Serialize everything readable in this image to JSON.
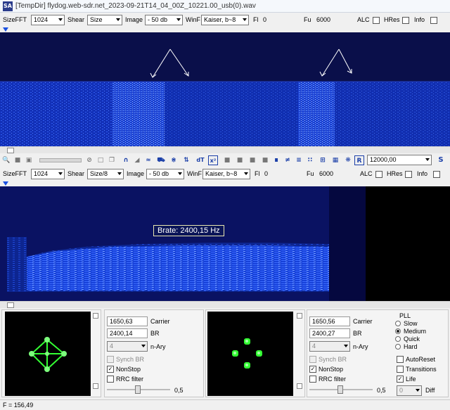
{
  "window": {
    "icon_text": "SA",
    "title": "[TempDir] flydog.web-sdr.net_2023-09-21T14_04_00Z_10221.00_usb(0).wav"
  },
  "top_controls": {
    "sizefft_label": "SizeFFT",
    "sizefft_value": "1024",
    "shear_label": "Shear",
    "shear_value": "Size",
    "image_label": "Image",
    "image_value": "- 50 db",
    "winf_label": "WinF",
    "winf_value": "Kaiser, b~8",
    "fl_label": "Fl",
    "fl_value": "0",
    "fu_label": "Fu",
    "fu_value": "6000",
    "alc_label": "ALC",
    "hres_label": "HRes",
    "info_label": "Info"
  },
  "toolbar": {
    "frequency_value": "12000,00",
    "s_button": "S",
    "r_button": "R"
  },
  "bottom_controls": {
    "sizefft_label": "SizeFFT",
    "sizefft_value": "1024",
    "shear_label": "Shear",
    "shear_value": "Size/8",
    "image_label": "Image",
    "image_value": "- 50 db",
    "winf_label": "WinF",
    "winf_value": "Kaiser, b~8",
    "fl_label": "Fl",
    "fl_value": "0",
    "fu_label": "Fu",
    "fu_value": "6000",
    "alc_label": "ALC",
    "hres_label": "HRes",
    "info_label": "Info"
  },
  "annotation": {
    "brate": "Brate: 2400,15 Hz"
  },
  "demod_left": {
    "carrier_value": "1650,63",
    "carrier_label": "Carrier",
    "br_value": "2400,14",
    "br_label": "BR",
    "nary_value": "4",
    "nary_label": "n-Ary",
    "synch_br": "Synch BR",
    "nonstop": "NonStop",
    "rrc_filter": "RRC filter",
    "slider_value": "0,5"
  },
  "demod_right": {
    "carrier_value": "1650,56",
    "carrier_label": "Carrier",
    "br_value": "2400,27",
    "br_label": "BR",
    "nary_value": "4",
    "nary_label": "n-Ary",
    "synch_br": "Synch BR",
    "nonstop": "NonStop",
    "rrc_filter": "RRC filter",
    "slider_value": "0,5",
    "pll_label": "PLL",
    "pll_options": [
      "Slow",
      "Medium",
      "Quick",
      "Hard"
    ],
    "pll_selected": "Medium",
    "autoreset": "AutoReset",
    "transitions": "Transitions",
    "life": "Life",
    "diff_value": "0",
    "diff_label": "Diff"
  },
  "status": {
    "frequency": "F = 156,49"
  },
  "colors": {
    "spectrum_bg": "#06093a",
    "signal": "#1e48e8",
    "accent": "#1a50e0",
    "constellation": "#33ff33"
  }
}
